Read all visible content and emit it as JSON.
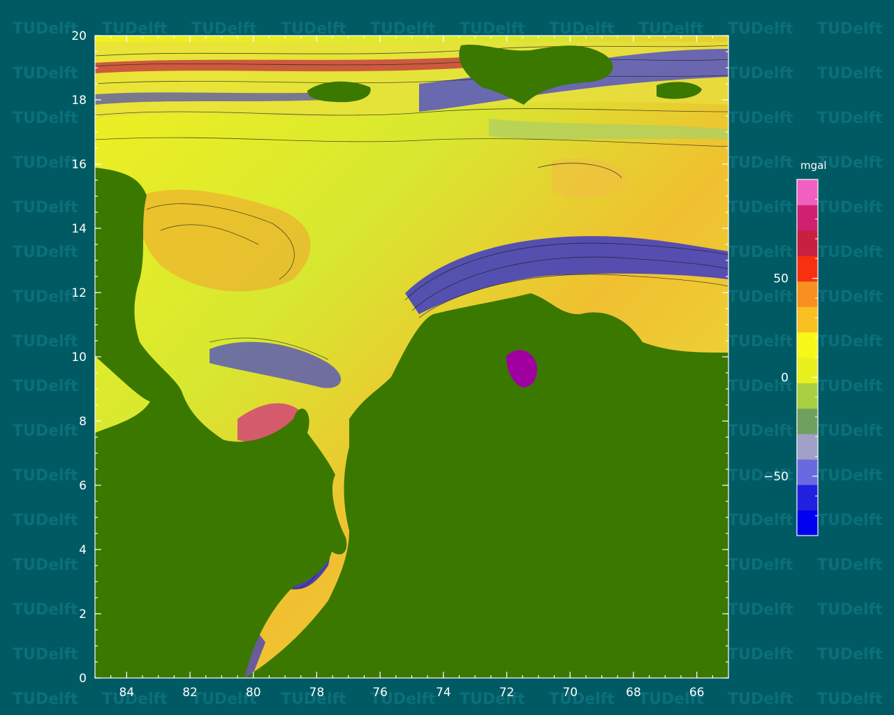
{
  "watermark": {
    "text": "TUDelft"
  },
  "map": {
    "x_ticks": [
      "84",
      "82",
      "80",
      "78",
      "76",
      "74",
      "72",
      "70",
      "68",
      "66"
    ],
    "y_ticks": [
      "0",
      "2",
      "4",
      "6",
      "8",
      "10",
      "12",
      "14",
      "16",
      "18",
      "20"
    ],
    "land_color": "#3a7800",
    "frame_color": "#ffffff"
  },
  "colorbar": {
    "unit": "mgal",
    "ticks": [
      "50",
      "0",
      "−50"
    ],
    "colors": [
      "#0000f0",
      "#2020e0",
      "#6a6ae0",
      "#a0a0c8",
      "#70a060",
      "#a8d040",
      "#e8f020",
      "#f8f818",
      "#f8c020",
      "#f89020",
      "#f83010",
      "#c82040",
      "#d02070",
      "#f060c0"
    ]
  },
  "chart_data": {
    "type": "heatmap",
    "xlabel": "",
    "ylabel": "",
    "xlim": [
      85,
      65
    ],
    "ylim": [
      0,
      20
    ],
    "xticks": [
      84,
      82,
      80,
      78,
      76,
      74,
      72,
      70,
      68,
      66
    ],
    "yticks": [
      0,
      2,
      4,
      6,
      8,
      10,
      12,
      14,
      16,
      18,
      20
    ],
    "colorbar_unit": "mgal",
    "colorbar_ticks": [
      50,
      0,
      -50
    ],
    "colorbar_range": [
      -80,
      100
    ]
  }
}
